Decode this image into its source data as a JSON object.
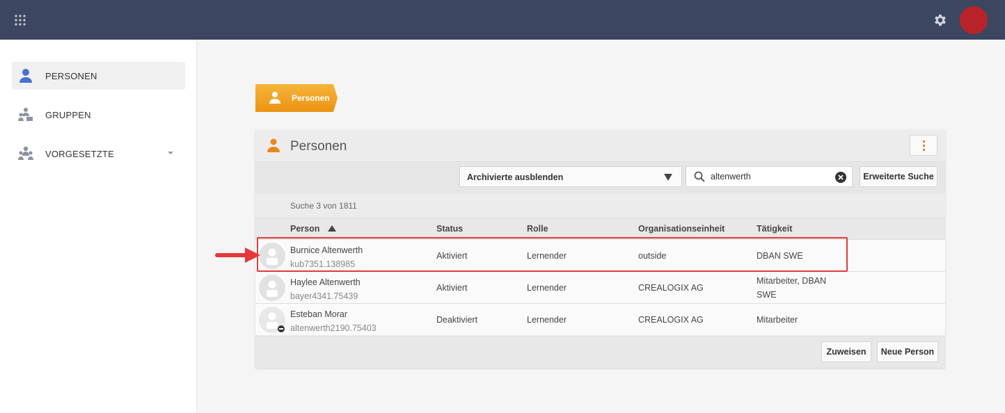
{
  "header": {
    "apps_icon": "grid-apps-icon",
    "settings_icon": "gear-icon",
    "avatar_color": "#b8232a",
    "bar_color": "#3c4660"
  },
  "sidebar": {
    "items": [
      {
        "label": "PERSONEN",
        "icon": "person-icon",
        "active": true
      },
      {
        "label": "GRUPPEN",
        "icon": "group-icon",
        "active": false
      },
      {
        "label": "VORGESETZTE",
        "icon": "supervisors-icon",
        "active": false,
        "expandable": true
      }
    ]
  },
  "breadcrumb": {
    "label": "Personen",
    "color": "#f0a21e"
  },
  "panel": {
    "title": "Personen",
    "accent": "#e8871e",
    "filter": {
      "selected": "Archivierte ausblenden"
    },
    "search": {
      "value": "altenwerth"
    },
    "extended_search_label": "Erweiterte Suche",
    "count": "Suche 3 von 1811",
    "columns": [
      "Person",
      "Status",
      "Rolle",
      "Organisationseinheit",
      "Tätigkeit"
    ],
    "rows": [
      {
        "name": "Burnice Altenwerth",
        "login": "kub7351.138985",
        "status": "Aktiviert",
        "role": "Lernender",
        "org": "outside",
        "activity": [
          "DBAN SWE"
        ],
        "deactivated": false,
        "highlighted": true
      },
      {
        "name": "Haylee Altenwerth",
        "login": "bayer4341.75439",
        "status": "Aktiviert",
        "role": "Lernender",
        "org": "CREALOGIX AG",
        "activity": [
          "Mitarbeiter, DBAN",
          "SWE"
        ],
        "deactivated": false,
        "highlighted": false
      },
      {
        "name": "Esteban Morar",
        "login": "altenwerth2190.75403",
        "status": "Deaktiviert",
        "role": "Lernender",
        "org": "CREALOGIX AG",
        "activity": [
          "Mitarbeiter"
        ],
        "deactivated": true,
        "highlighted": false
      }
    ],
    "buttons": {
      "assign": "Zuweisen",
      "new_person": "Neue Person"
    }
  },
  "annotation": {
    "color": "#e5383b"
  }
}
